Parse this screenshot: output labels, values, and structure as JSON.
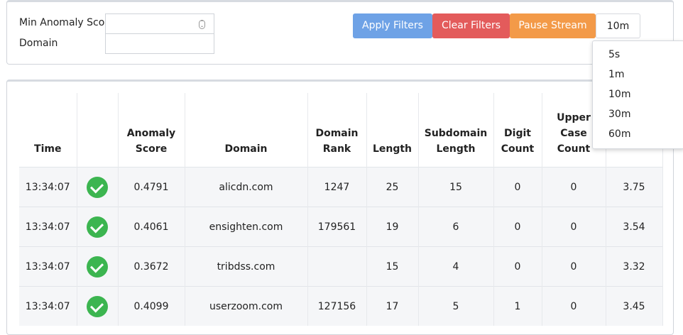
{
  "filters": {
    "min_anomaly_label": "Min Anomaly Score",
    "min_anomaly_value": "",
    "domain_label": "Domain",
    "domain_value": ""
  },
  "buttons": {
    "apply": "Apply Filters",
    "clear": "Clear Filters",
    "pause": "Pause Stream",
    "interval": "10m"
  },
  "interval_options": [
    "5s",
    "1m",
    "10m",
    "30m",
    "60m"
  ],
  "colors": {
    "apply": "#6ea2e6",
    "clear": "#e35b5b",
    "pause": "#f39a48",
    "check": "#3cb550"
  },
  "table": {
    "headers": {
      "time": "Time",
      "status": "",
      "anomaly": [
        "Anomaly",
        "Score"
      ],
      "domain": "Domain",
      "rank": [
        "Domain",
        "Rank"
      ],
      "length": "Length",
      "subdomain": [
        "Subdomain",
        "Length"
      ],
      "digit": [
        "Digit",
        "Count"
      ],
      "upper": [
        "Upper",
        "Case",
        "Count"
      ],
      "entropy": ""
    },
    "rows": [
      {
        "time": "13:34:07",
        "status": "check-icon",
        "score": "0.4791",
        "domain": "alicdn.com",
        "rank": "1247",
        "length": "25",
        "sub": "15",
        "digit": "0",
        "upper": "0",
        "entropy": "3.75"
      },
      {
        "time": "13:34:07",
        "status": "check-icon",
        "score": "0.4061",
        "domain": "ensighten.com",
        "rank": "179561",
        "length": "19",
        "sub": "6",
        "digit": "0",
        "upper": "0",
        "entropy": "3.54"
      },
      {
        "time": "13:34:07",
        "status": "check-icon",
        "score": "0.3672",
        "domain": "tribdss.com",
        "rank": "",
        "length": "15",
        "sub": "4",
        "digit": "0",
        "upper": "0",
        "entropy": "3.32"
      },
      {
        "time": "13:34:07",
        "status": "check-icon",
        "score": "0.4099",
        "domain": "userzoom.com",
        "rank": "127156",
        "length": "17",
        "sub": "5",
        "digit": "1",
        "upper": "0",
        "entropy": "3.45"
      }
    ]
  }
}
